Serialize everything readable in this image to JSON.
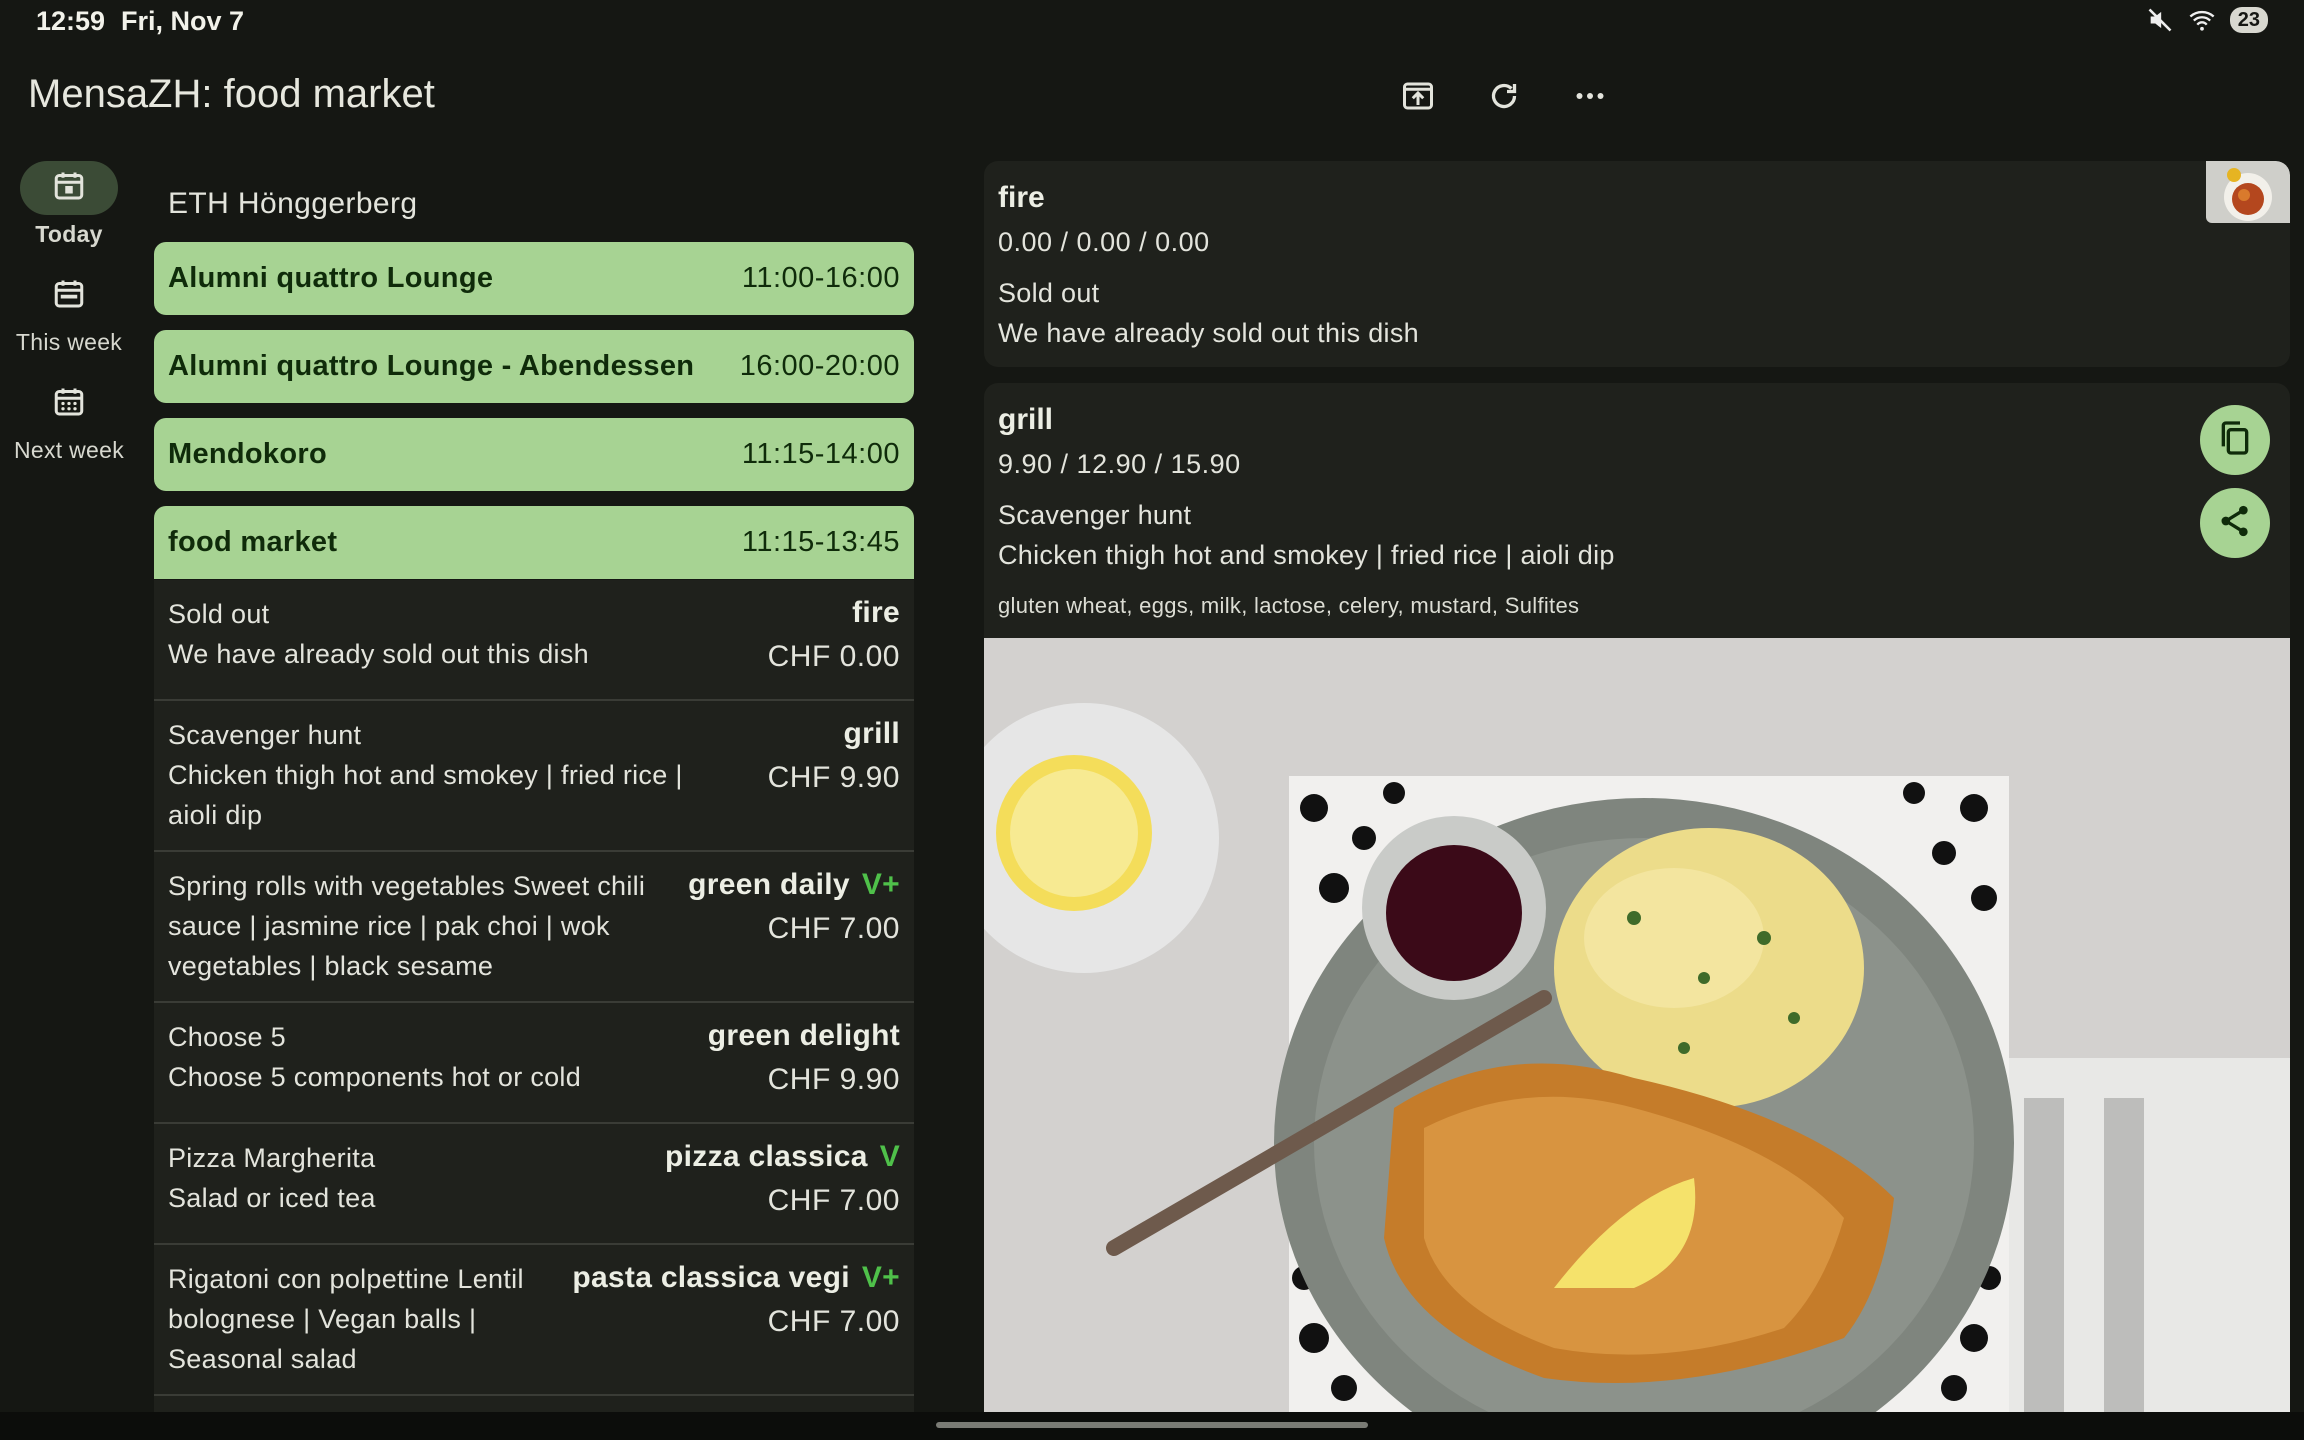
{
  "status": {
    "time": "12:59",
    "date": "Fri, Nov 7",
    "battery": "23"
  },
  "app": {
    "title": "MensaZH: food market"
  },
  "nav": [
    {
      "label": "Today"
    },
    {
      "label": "This week"
    },
    {
      "label": "Next week"
    }
  ],
  "campus": "ETH Hönggerberg",
  "canteens": [
    {
      "name": "Alumni quattro Lounge",
      "hours": "11:00-16:00"
    },
    {
      "name": "Alumni quattro Lounge - Abendessen",
      "hours": "16:00-20:00"
    },
    {
      "name": "Mendokoro",
      "hours": "11:15-14:00"
    },
    {
      "name": "food market",
      "hours": "11:15-13:45"
    }
  ],
  "menus": [
    {
      "text": "Sold out\nWe have already sold out this dish",
      "station": "fire",
      "veg": "",
      "price": "CHF 0.00"
    },
    {
      "text": "Scavenger hunt\nChicken thigh hot and smokey | fried rice | aioli dip",
      "station": "grill",
      "veg": "",
      "price": "CHF 9.90"
    },
    {
      "text": "Spring rolls with vegetables\nSweet chili sauce | jasmine rice | pak choi | wok vegetables | black sesame",
      "station": "green daily",
      "veg": "V+",
      "price": "CHF 7.00"
    },
    {
      "text": "Choose 5\nChoose 5 components hot or cold",
      "station": "green delight",
      "veg": "",
      "price": "CHF 9.90"
    },
    {
      "text": "Pizza Margherita\nSalad or iced tea",
      "station": "pizza classica",
      "veg": "V",
      "price": "CHF 7.00"
    },
    {
      "text": "Rigatoni con polpettine\nLentil bolognese | Vegan balls | Seasonal salad",
      "station": "pasta classica vegi",
      "veg": "V+",
      "price": "CHF 7.00"
    }
  ],
  "detail": {
    "fire": {
      "station": "fire",
      "prices": "0.00 / 0.00 / 0.00",
      "title": "Sold out",
      "description": "We have already sold out this dish"
    },
    "grill": {
      "station": "grill",
      "prices": "9.90 / 12.90 / 15.90",
      "title": "Scavenger hunt",
      "description": "Chicken thigh hot and smokey | fried rice | aioli dip",
      "allergens": "gluten wheat, eggs, milk, lactose, celery, mustard, Sulfites"
    }
  },
  "colors": {
    "accent": "#a7d393",
    "veg": "#4fc14a",
    "background": "#151713",
    "surface": "#1f211c"
  }
}
